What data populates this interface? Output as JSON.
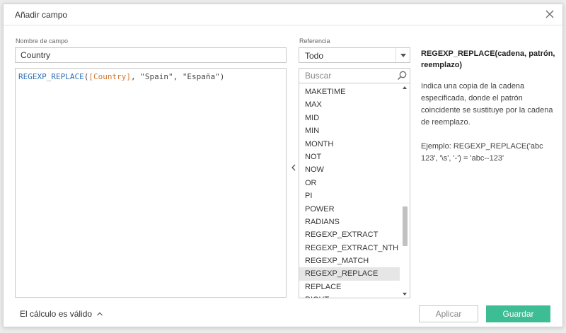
{
  "dialog": {
    "title": "Añadir campo"
  },
  "field_name": {
    "label": "Nombre de campo",
    "value": "Country"
  },
  "formula": {
    "tokens": [
      {
        "type": "func",
        "text": "REGEXP_REPLACE"
      },
      {
        "type": "punc",
        "text": "("
      },
      {
        "type": "field",
        "text": "[Country]"
      },
      {
        "type": "punc",
        "text": ", "
      },
      {
        "type": "str",
        "text": "\"Spain\""
      },
      {
        "type": "punc",
        "text": ", "
      },
      {
        "type": "str",
        "text": "\"España\""
      },
      {
        "type": "punc",
        "text": ")"
      }
    ]
  },
  "reference": {
    "label": "Referencia",
    "selected": "Todo",
    "search_placeholder": "Buscar",
    "functions": [
      "MAKETIME",
      "MAX",
      "MID",
      "MIN",
      "MONTH",
      "NOT",
      "NOW",
      "OR",
      "PI",
      "POWER",
      "RADIANS",
      "REGEXP_EXTRACT",
      "REGEXP_EXTRACT_NTH",
      "REGEXP_MATCH",
      "REGEXP_REPLACE",
      "REPLACE",
      "RIGHT"
    ],
    "selected_function": "REGEXP_REPLACE"
  },
  "help": {
    "signature": "REGEXP_REPLACE(cadena, patrón, reemplazo)",
    "description": "Indica una copia de la cadena especificada, donde el patrón coincidente se sustituye por la cadena de reemplazo.",
    "example": "Ejemplo: REGEXP_REPLACE('abc 123', '\\s', '-') = 'abc--123'"
  },
  "footer": {
    "status": "El cálculo es válido",
    "apply_label": "Aplicar",
    "save_label": "Guardar"
  },
  "colors": {
    "accent": "#3dbd94",
    "function_token": "#2d6fb5",
    "field_token": "#d6762c",
    "selected_row": "#e6e6e6"
  },
  "icons": {
    "close": "close-icon",
    "dropdown": "chevron-down-icon",
    "search": "search-icon",
    "collapse": "chevron-left-icon",
    "status": "chevron-up-icon"
  }
}
